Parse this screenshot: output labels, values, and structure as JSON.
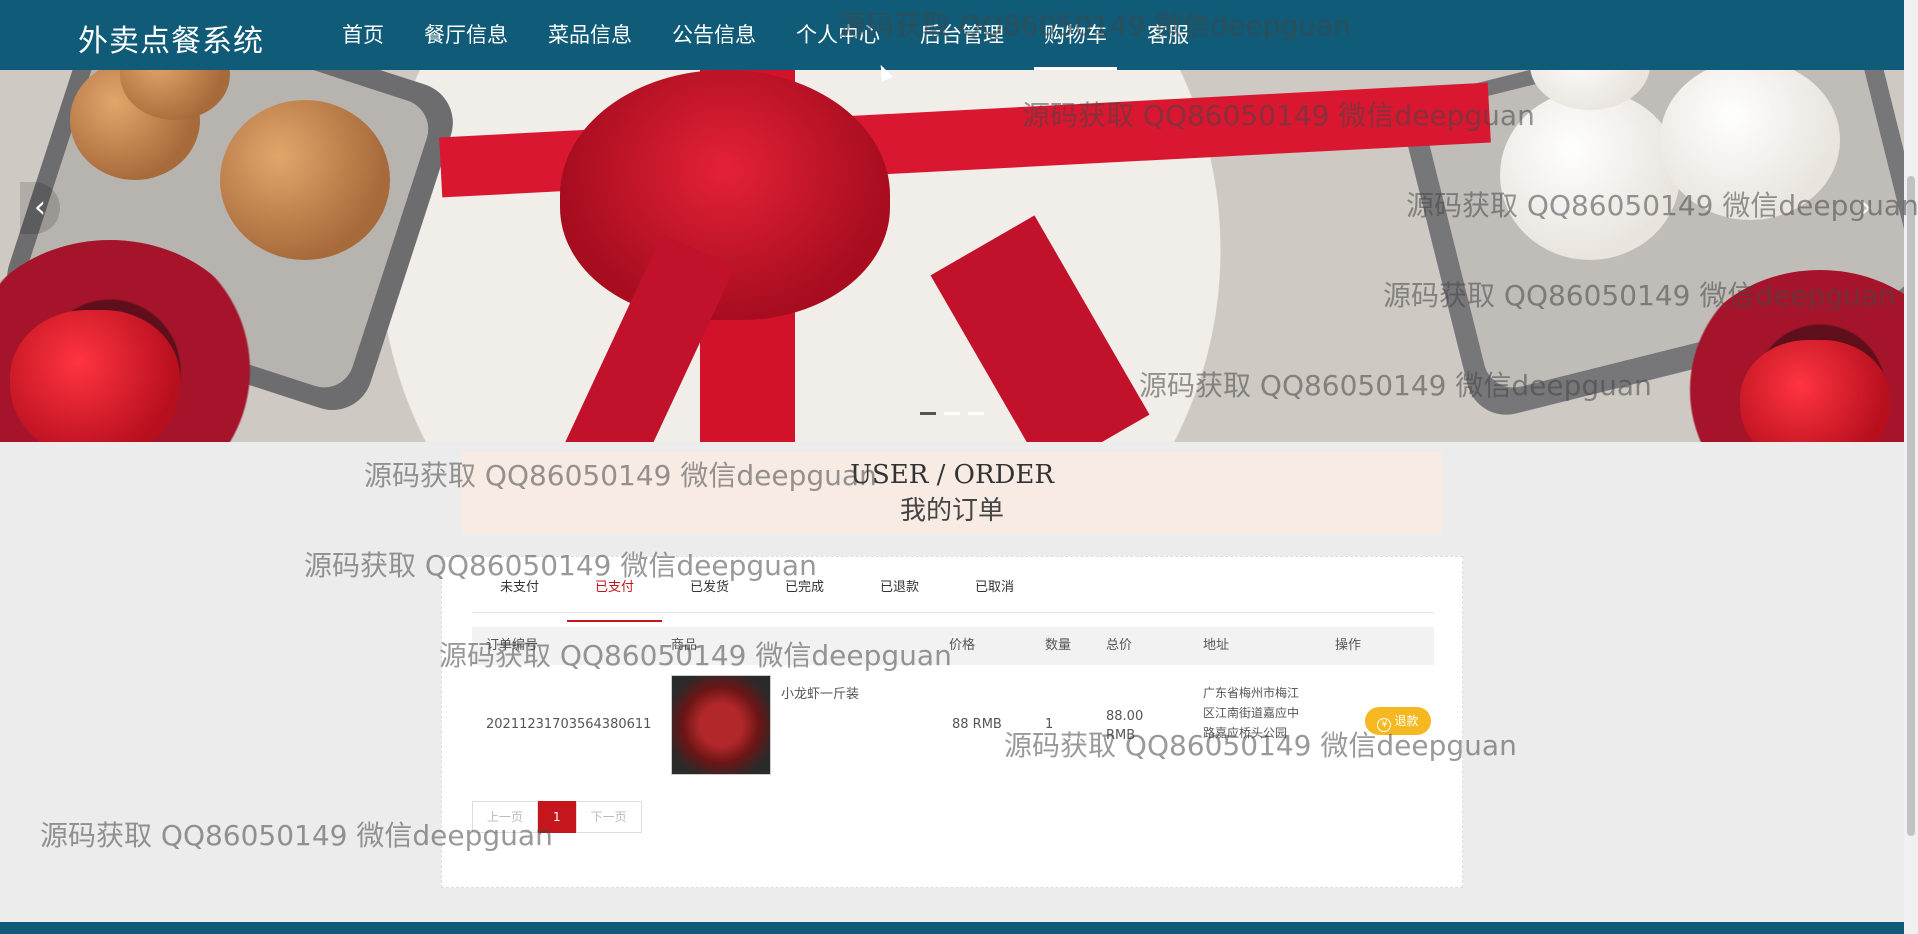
{
  "header": {
    "brand": "外卖点餐系统",
    "nav": [
      "首页",
      "餐厅信息",
      "菜品信息",
      "公告信息",
      "个人中心",
      "后台管理",
      "购物车",
      "客服"
    ],
    "active_nav": "购物车"
  },
  "banner": {
    "prev_icon": "chevron-left-icon",
    "next_icon": "chevron-right-icon",
    "prev": "‹",
    "next": "›",
    "dots": 3,
    "active_dot": 1
  },
  "title": {
    "en": "USER / ORDER",
    "cn": "我的订单"
  },
  "orders": {
    "tabs": [
      "未支付",
      "已支付",
      "已发货",
      "已完成",
      "已退款",
      "已取消"
    ],
    "active_tab": "已支付",
    "columns": [
      "订单编号",
      "商品",
      "价格",
      "数量",
      "总价",
      "地址",
      "操作"
    ],
    "rows": [
      {
        "order_no": "20211231703564380611",
        "product": "小龙虾一斤装",
        "price": "88 RMB",
        "quantity": "1",
        "total": "88.00 RMB",
        "address": "广东省梅州市梅江区江南街道嘉应中路嘉应桥头公园",
        "action": "退款"
      }
    ]
  },
  "pager": {
    "prev": "上一页",
    "current": "1",
    "next": "下一页"
  },
  "watermark": "源码获取 QQ86050149 微信deepguan",
  "colors": {
    "header": "#0f5b78",
    "accent": "#c4161c",
    "refund": "#f5b820"
  }
}
